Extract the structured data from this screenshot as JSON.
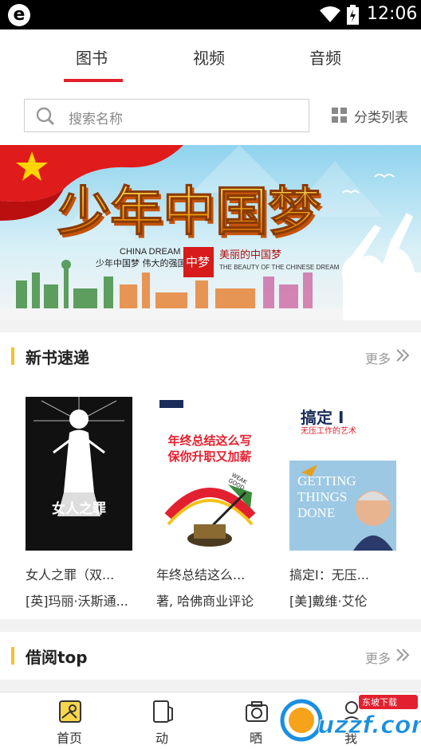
{
  "status_bar": {
    "app_icon_letter": "e",
    "time": "12:06"
  },
  "tabs": [
    {
      "label": "图书",
      "active": true
    },
    {
      "label": "视频",
      "active": false
    },
    {
      "label": "音频",
      "active": false
    }
  ],
  "search": {
    "placeholder": "搜索名称"
  },
  "category_list_label": "分类列表",
  "banner": {
    "headline": "少年中国梦",
    "english_left": "CHINA DREAM",
    "sub_left": "少年中国梦 伟大的强国梦",
    "seal_text": "中梦",
    "sub_right": "美丽的中国梦",
    "english_right": "THE BEAUTY OF THE CHINESE DREAM"
  },
  "sections": {
    "new_books": {
      "title": "新书速递",
      "more": "更多"
    },
    "borrow": {
      "title": "借阅top",
      "more": "更多"
    }
  },
  "books": [
    {
      "title": "女人之罪（双...",
      "author": "[英]玛丽·沃斯通...",
      "cover_title": "女人之罪"
    },
    {
      "title": "年终总结这么...",
      "author": "著, 哈佛商业评论",
      "cover_line1": "年终总结这么写",
      "cover_line2": "保你升职又加薪",
      "cover_gauge_text": "WEAK GOOD"
    },
    {
      "title": "搞定Ⅰ：无压...",
      "author": "[美]戴维·艾伦",
      "cover_title": "搞定 I",
      "cover_subtitle": "无压工作的艺术",
      "cover_en1": "GETTING",
      "cover_en2": "THINGS",
      "cover_en3": "DONE"
    }
  ],
  "bottom_nav": [
    {
      "label": "首页",
      "icon": "home-icon",
      "active": true
    },
    {
      "label": "动",
      "icon": "activity-icon",
      "active": false
    },
    {
      "label": "晒",
      "icon": "camera-icon",
      "active": false
    },
    {
      "label": "我",
      "icon": "profile-icon",
      "active": false
    }
  ],
  "watermark": {
    "text": "uzzf.com",
    "badge": "东坡下载"
  },
  "colors": {
    "accent": "#e3202f",
    "section_bar": "#f5c22a"
  }
}
